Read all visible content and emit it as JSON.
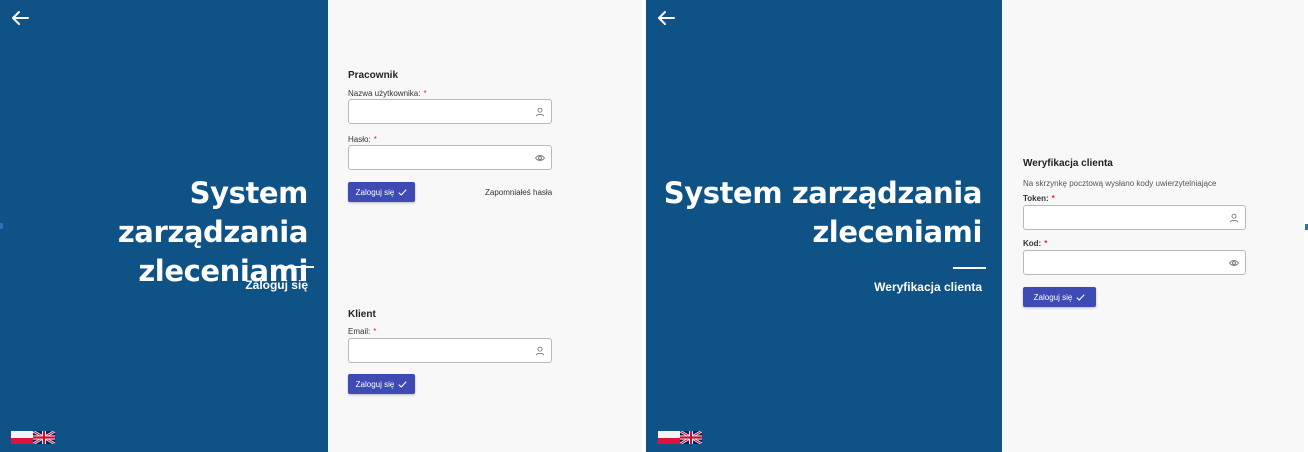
{
  "accent_color": "#0f5286",
  "button_color": "#3f4bb5",
  "left_screen": {
    "back_icon": "arrow-left-icon",
    "hero": {
      "title_line1": "System zarządzania",
      "title_line2": "zleceniami",
      "subtitle": "Zaloguj się"
    },
    "languages": [
      "pl-flag-icon",
      "uk-flag-icon"
    ],
    "employee": {
      "title": "Pracownik",
      "username_label": "Nazwa użytkownika:",
      "username_icon": "user-icon",
      "password_label": "Hasło:",
      "password_icon": "eye-icon",
      "required_mark": "*",
      "login_button": "Zaloguj się",
      "forgot_link": "Zapomniałeś hasła"
    },
    "client": {
      "title": "Klient",
      "email_label": "Email:",
      "email_icon": "user-icon",
      "required_mark": "*",
      "login_button": "Zaloguj się"
    }
  },
  "right_screen": {
    "back_icon": "arrow-left-icon",
    "hero": {
      "title_line1": "System zarządzania",
      "title_line2": "zleceniami",
      "subtitle": "Weryfikacja clienta"
    },
    "languages": [
      "pl-flag-icon",
      "uk-flag-icon"
    ],
    "verification": {
      "title": "Weryfikacja clienta",
      "description": "Na skrzynkę pocztową wysłano kody uwierzytelniające",
      "token_label": "Token:",
      "token_icon": "user-icon",
      "code_label": "Kod:",
      "code_icon": "eye-icon",
      "required_mark": "*",
      "login_button": "Zaloguj się"
    }
  }
}
